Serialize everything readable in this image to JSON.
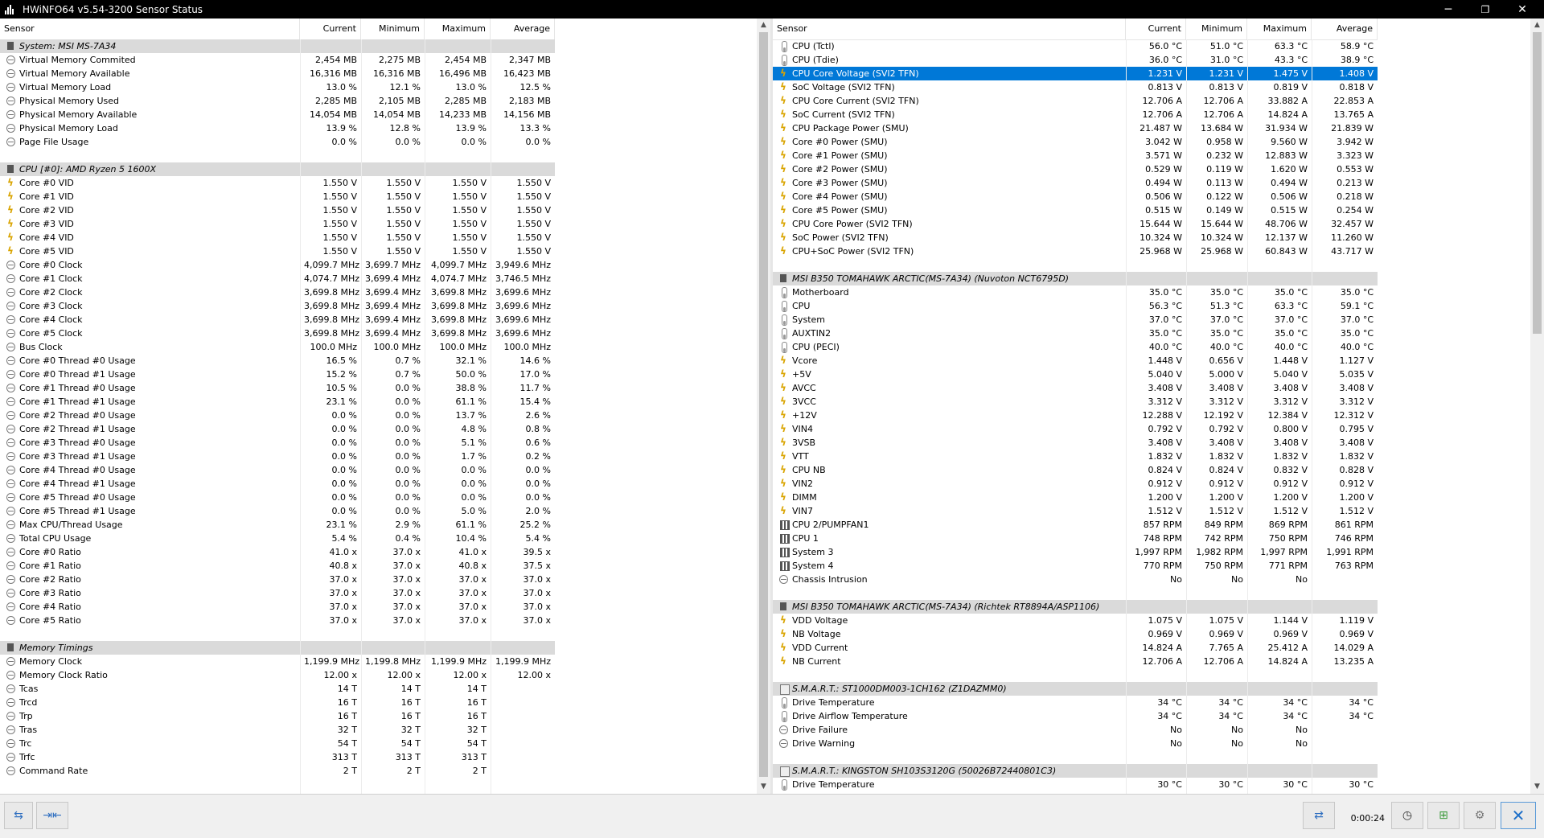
{
  "window": {
    "title": "HWiNFO64 v5.54-3200 Sensor Status",
    "minimize_glyph": "─",
    "maximize_glyph": "❐",
    "close_glyph": "✕"
  },
  "columns": [
    "Sensor",
    "Current",
    "Minimum",
    "Maximum",
    "Average"
  ],
  "left_rows": [
    {
      "t": "group",
      "icon": "chip",
      "name": "System: MSI MS-7A34"
    },
    {
      "icon": "clock",
      "name": "Virtual Memory Commited",
      "v": [
        "2,454 MB",
        "2,275 MB",
        "2,454 MB",
        "2,347 MB"
      ]
    },
    {
      "icon": "clock",
      "name": "Virtual Memory Available",
      "v": [
        "16,316 MB",
        "16,316 MB",
        "16,496 MB",
        "16,423 MB"
      ]
    },
    {
      "icon": "clock",
      "name": "Virtual Memory Load",
      "v": [
        "13.0 %",
        "12.1 %",
        "13.0 %",
        "12.5 %"
      ]
    },
    {
      "icon": "clock",
      "name": "Physical Memory Used",
      "v": [
        "2,285 MB",
        "2,105 MB",
        "2,285 MB",
        "2,183 MB"
      ]
    },
    {
      "icon": "clock",
      "name": "Physical Memory Available",
      "v": [
        "14,054 MB",
        "14,054 MB",
        "14,233 MB",
        "14,156 MB"
      ]
    },
    {
      "icon": "clock",
      "name": "Physical Memory Load",
      "v": [
        "13.9 %",
        "12.8 %",
        "13.9 %",
        "13.3 %"
      ]
    },
    {
      "icon": "clock",
      "name": "Page File Usage",
      "v": [
        "0.0 %",
        "0.0 %",
        "0.0 %",
        "0.0 %"
      ]
    },
    {
      "t": "spacer"
    },
    {
      "t": "group",
      "icon": "chip",
      "name": "CPU [#0]: AMD Ryzen 5 1600X"
    },
    {
      "icon": "volt",
      "name": "Core #0 VID",
      "v": [
        "1.550 V",
        "1.550 V",
        "1.550 V",
        "1.550 V"
      ]
    },
    {
      "icon": "volt",
      "name": "Core #1 VID",
      "v": [
        "1.550 V",
        "1.550 V",
        "1.550 V",
        "1.550 V"
      ]
    },
    {
      "icon": "volt",
      "name": "Core #2 VID",
      "v": [
        "1.550 V",
        "1.550 V",
        "1.550 V",
        "1.550 V"
      ]
    },
    {
      "icon": "volt",
      "name": "Core #3 VID",
      "v": [
        "1.550 V",
        "1.550 V",
        "1.550 V",
        "1.550 V"
      ]
    },
    {
      "icon": "volt",
      "name": "Core #4 VID",
      "v": [
        "1.550 V",
        "1.550 V",
        "1.550 V",
        "1.550 V"
      ]
    },
    {
      "icon": "volt",
      "name": "Core #5 VID",
      "v": [
        "1.550 V",
        "1.550 V",
        "1.550 V",
        "1.550 V"
      ]
    },
    {
      "icon": "clock",
      "name": "Core #0 Clock",
      "v": [
        "4,099.7 MHz",
        "3,699.7 MHz",
        "4,099.7 MHz",
        "3,949.6 MHz"
      ]
    },
    {
      "icon": "clock",
      "name": "Core #1 Clock",
      "v": [
        "4,074.7 MHz",
        "3,699.4 MHz",
        "4,074.7 MHz",
        "3,746.5 MHz"
      ]
    },
    {
      "icon": "clock",
      "name": "Core #2 Clock",
      "v": [
        "3,699.8 MHz",
        "3,699.4 MHz",
        "3,699.8 MHz",
        "3,699.6 MHz"
      ]
    },
    {
      "icon": "clock",
      "name": "Core #3 Clock",
      "v": [
        "3,699.8 MHz",
        "3,699.4 MHz",
        "3,699.8 MHz",
        "3,699.6 MHz"
      ]
    },
    {
      "icon": "clock",
      "name": "Core #4 Clock",
      "v": [
        "3,699.8 MHz",
        "3,699.4 MHz",
        "3,699.8 MHz",
        "3,699.6 MHz"
      ]
    },
    {
      "icon": "clock",
      "name": "Core #5 Clock",
      "v": [
        "3,699.8 MHz",
        "3,699.4 MHz",
        "3,699.8 MHz",
        "3,699.6 MHz"
      ]
    },
    {
      "icon": "clock",
      "name": "Bus Clock",
      "v": [
        "100.0 MHz",
        "100.0 MHz",
        "100.0 MHz",
        "100.0 MHz"
      ]
    },
    {
      "icon": "clock",
      "name": "Core #0 Thread #0 Usage",
      "v": [
        "16.5 %",
        "0.7 %",
        "32.1 %",
        "14.6 %"
      ]
    },
    {
      "icon": "clock",
      "name": "Core #0 Thread #1 Usage",
      "v": [
        "15.2 %",
        "0.7 %",
        "50.0 %",
        "17.0 %"
      ]
    },
    {
      "icon": "clock",
      "name": "Core #1 Thread #0 Usage",
      "v": [
        "10.5 %",
        "0.0 %",
        "38.8 %",
        "11.7 %"
      ]
    },
    {
      "icon": "clock",
      "name": "Core #1 Thread #1 Usage",
      "v": [
        "23.1 %",
        "0.0 %",
        "61.1 %",
        "15.4 %"
      ]
    },
    {
      "icon": "clock",
      "name": "Core #2 Thread #0 Usage",
      "v": [
        "0.0 %",
        "0.0 %",
        "13.7 %",
        "2.6 %"
      ]
    },
    {
      "icon": "clock",
      "name": "Core #2 Thread #1 Usage",
      "v": [
        "0.0 %",
        "0.0 %",
        "4.8 %",
        "0.8 %"
      ]
    },
    {
      "icon": "clock",
      "name": "Core #3 Thread #0 Usage",
      "v": [
        "0.0 %",
        "0.0 %",
        "5.1 %",
        "0.6 %"
      ]
    },
    {
      "icon": "clock",
      "name": "Core #3 Thread #1 Usage",
      "v": [
        "0.0 %",
        "0.0 %",
        "1.7 %",
        "0.2 %"
      ]
    },
    {
      "icon": "clock",
      "name": "Core #4 Thread #0 Usage",
      "v": [
        "0.0 %",
        "0.0 %",
        "0.0 %",
        "0.0 %"
      ]
    },
    {
      "icon": "clock",
      "name": "Core #4 Thread #1 Usage",
      "v": [
        "0.0 %",
        "0.0 %",
        "0.0 %",
        "0.0 %"
      ]
    },
    {
      "icon": "clock",
      "name": "Core #5 Thread #0 Usage",
      "v": [
        "0.0 %",
        "0.0 %",
        "0.0 %",
        "0.0 %"
      ]
    },
    {
      "icon": "clock",
      "name": "Core #5 Thread #1 Usage",
      "v": [
        "0.0 %",
        "0.0 %",
        "5.0 %",
        "2.0 %"
      ]
    },
    {
      "icon": "clock",
      "name": "Max CPU/Thread Usage",
      "v": [
        "23.1 %",
        "2.9 %",
        "61.1 %",
        "25.2 %"
      ]
    },
    {
      "icon": "clock",
      "name": "Total CPU Usage",
      "v": [
        "5.4 %",
        "0.4 %",
        "10.4 %",
        "5.4 %"
      ]
    },
    {
      "icon": "clock",
      "name": "Core #0 Ratio",
      "v": [
        "41.0 x",
        "37.0 x",
        "41.0 x",
        "39.5 x"
      ]
    },
    {
      "icon": "clock",
      "name": "Core #1 Ratio",
      "v": [
        "40.8 x",
        "37.0 x",
        "40.8 x",
        "37.5 x"
      ]
    },
    {
      "icon": "clock",
      "name": "Core #2 Ratio",
      "v": [
        "37.0 x",
        "37.0 x",
        "37.0 x",
        "37.0 x"
      ]
    },
    {
      "icon": "clock",
      "name": "Core #3 Ratio",
      "v": [
        "37.0 x",
        "37.0 x",
        "37.0 x",
        "37.0 x"
      ]
    },
    {
      "icon": "clock",
      "name": "Core #4 Ratio",
      "v": [
        "37.0 x",
        "37.0 x",
        "37.0 x",
        "37.0 x"
      ]
    },
    {
      "icon": "clock",
      "name": "Core #5 Ratio",
      "v": [
        "37.0 x",
        "37.0 x",
        "37.0 x",
        "37.0 x"
      ]
    },
    {
      "t": "spacer"
    },
    {
      "t": "group",
      "icon": "chip",
      "name": "Memory Timings"
    },
    {
      "icon": "clock",
      "name": "Memory Clock",
      "v": [
        "1,199.9 MHz",
        "1,199.8 MHz",
        "1,199.9 MHz",
        "1,199.9 MHz"
      ]
    },
    {
      "icon": "clock",
      "name": "Memory Clock Ratio",
      "v": [
        "12.00 x",
        "12.00 x",
        "12.00 x",
        "12.00 x"
      ]
    },
    {
      "icon": "clock",
      "name": "Tcas",
      "v": [
        "14 T",
        "14 T",
        "14 T",
        ""
      ]
    },
    {
      "icon": "clock",
      "name": "Trcd",
      "v": [
        "16 T",
        "16 T",
        "16 T",
        ""
      ]
    },
    {
      "icon": "clock",
      "name": "Trp",
      "v": [
        "16 T",
        "16 T",
        "16 T",
        ""
      ]
    },
    {
      "icon": "clock",
      "name": "Tras",
      "v": [
        "32 T",
        "32 T",
        "32 T",
        ""
      ]
    },
    {
      "icon": "clock",
      "name": "Trc",
      "v": [
        "54 T",
        "54 T",
        "54 T",
        ""
      ]
    },
    {
      "icon": "clock",
      "name": "Trfc",
      "v": [
        "313 T",
        "313 T",
        "313 T",
        ""
      ]
    },
    {
      "icon": "clock",
      "name": "Command Rate",
      "v": [
        "2 T",
        "2 T",
        "2 T",
        ""
      ]
    }
  ],
  "right_rows": [
    {
      "icon": "temp",
      "name": "CPU (Tctl)",
      "v": [
        "56.0 °C",
        "51.0 °C",
        "63.3 °C",
        "58.9 °C"
      ]
    },
    {
      "icon": "temp",
      "name": "CPU (Tdie)",
      "v": [
        "36.0 °C",
        "31.0 °C",
        "43.3 °C",
        "38.9 °C"
      ]
    },
    {
      "icon": "volt",
      "name": "CPU Core Voltage (SVI2 TFN)",
      "v": [
        "1.231 V",
        "1.231 V",
        "1.475 V",
        "1.408 V"
      ],
      "selected": true
    },
    {
      "icon": "volt",
      "name": "SoC Voltage (SVI2 TFN)",
      "v": [
        "0.813 V",
        "0.813 V",
        "0.819 V",
        "0.818 V"
      ]
    },
    {
      "icon": "volt",
      "name": "CPU Core Current (SVI2 TFN)",
      "v": [
        "12.706 A",
        "12.706 A",
        "33.882 A",
        "22.853 A"
      ]
    },
    {
      "icon": "volt",
      "name": "SoC Current (SVI2 TFN)",
      "v": [
        "12.706 A",
        "12.706 A",
        "14.824 A",
        "13.765 A"
      ]
    },
    {
      "icon": "volt",
      "name": "CPU Package Power (SMU)",
      "v": [
        "21.487 W",
        "13.684 W",
        "31.934 W",
        "21.839 W"
      ]
    },
    {
      "icon": "volt",
      "name": "Core #0 Power (SMU)",
      "v": [
        "3.042 W",
        "0.958 W",
        "9.560 W",
        "3.942 W"
      ]
    },
    {
      "icon": "volt",
      "name": "Core #1 Power (SMU)",
      "v": [
        "3.571 W",
        "0.232 W",
        "12.883 W",
        "3.323 W"
      ]
    },
    {
      "icon": "volt",
      "name": "Core #2 Power (SMU)",
      "v": [
        "0.529 W",
        "0.119 W",
        "1.620 W",
        "0.553 W"
      ]
    },
    {
      "icon": "volt",
      "name": "Core #3 Power (SMU)",
      "v": [
        "0.494 W",
        "0.113 W",
        "0.494 W",
        "0.213 W"
      ]
    },
    {
      "icon": "volt",
      "name": "Core #4 Power (SMU)",
      "v": [
        "0.506 W",
        "0.122 W",
        "0.506 W",
        "0.218 W"
      ]
    },
    {
      "icon": "volt",
      "name": "Core #5 Power (SMU)",
      "v": [
        "0.515 W",
        "0.149 W",
        "0.515 W",
        "0.254 W"
      ]
    },
    {
      "icon": "volt",
      "name": "CPU Core Power (SVI2 TFN)",
      "v": [
        "15.644 W",
        "15.644 W",
        "48.706 W",
        "32.457 W"
      ]
    },
    {
      "icon": "volt",
      "name": "SoC Power (SVI2 TFN)",
      "v": [
        "10.324 W",
        "10.324 W",
        "12.137 W",
        "11.260 W"
      ]
    },
    {
      "icon": "volt",
      "name": "CPU+SoC Power (SVI2 TFN)",
      "v": [
        "25.968 W",
        "25.968 W",
        "60.843 W",
        "43.717 W"
      ]
    },
    {
      "t": "spacer"
    },
    {
      "t": "group",
      "icon": "chip",
      "name": "MSI B350 TOMAHAWK ARCTIC(MS-7A34) (Nuvoton NCT6795D)"
    },
    {
      "icon": "temp",
      "name": "Motherboard",
      "v": [
        "35.0 °C",
        "35.0 °C",
        "35.0 °C",
        "35.0 °C"
      ]
    },
    {
      "icon": "temp",
      "name": "CPU",
      "v": [
        "56.3 °C",
        "51.3 °C",
        "63.3 °C",
        "59.1 °C"
      ]
    },
    {
      "icon": "temp",
      "name": "System",
      "v": [
        "37.0 °C",
        "37.0 °C",
        "37.0 °C",
        "37.0 °C"
      ]
    },
    {
      "icon": "temp",
      "name": "AUXTIN2",
      "v": [
        "35.0 °C",
        "35.0 °C",
        "35.0 °C",
        "35.0 °C"
      ]
    },
    {
      "icon": "temp",
      "name": "CPU (PECI)",
      "v": [
        "40.0 °C",
        "40.0 °C",
        "40.0 °C",
        "40.0 °C"
      ]
    },
    {
      "icon": "volt",
      "name": "Vcore",
      "v": [
        "1.448 V",
        "0.656 V",
        "1.448 V",
        "1.127 V"
      ]
    },
    {
      "icon": "volt",
      "name": "+5V",
      "v": [
        "5.040 V",
        "5.000 V",
        "5.040 V",
        "5.035 V"
      ]
    },
    {
      "icon": "volt",
      "name": "AVCC",
      "v": [
        "3.408 V",
        "3.408 V",
        "3.408 V",
        "3.408 V"
      ]
    },
    {
      "icon": "volt",
      "name": "3VCC",
      "v": [
        "3.312 V",
        "3.312 V",
        "3.312 V",
        "3.312 V"
      ]
    },
    {
      "icon": "volt",
      "name": "+12V",
      "v": [
        "12.288 V",
        "12.192 V",
        "12.384 V",
        "12.312 V"
      ]
    },
    {
      "icon": "volt",
      "name": "VIN4",
      "v": [
        "0.792 V",
        "0.792 V",
        "0.800 V",
        "0.795 V"
      ]
    },
    {
      "icon": "volt",
      "name": "3VSB",
      "v": [
        "3.408 V",
        "3.408 V",
        "3.408 V",
        "3.408 V"
      ]
    },
    {
      "icon": "volt",
      "name": "VTT",
      "v": [
        "1.832 V",
        "1.832 V",
        "1.832 V",
        "1.832 V"
      ]
    },
    {
      "icon": "volt",
      "name": "CPU NB",
      "v": [
        "0.824 V",
        "0.824 V",
        "0.832 V",
        "0.828 V"
      ]
    },
    {
      "icon": "volt",
      "name": "VIN2",
      "v": [
        "0.912 V",
        "0.912 V",
        "0.912 V",
        "0.912 V"
      ]
    },
    {
      "icon": "volt",
      "name": "DIMM",
      "v": [
        "1.200 V",
        "1.200 V",
        "1.200 V",
        "1.200 V"
      ]
    },
    {
      "icon": "volt",
      "name": "VIN7",
      "v": [
        "1.512 V",
        "1.512 V",
        "1.512 V",
        "1.512 V"
      ]
    },
    {
      "icon": "fan",
      "name": "CPU 2/PUMPFAN1",
      "v": [
        "857 RPM",
        "849 RPM",
        "869 RPM",
        "861 RPM"
      ]
    },
    {
      "icon": "fan",
      "name": "CPU 1",
      "v": [
        "748 RPM",
        "742 RPM",
        "750 RPM",
        "746 RPM"
      ]
    },
    {
      "icon": "fan",
      "name": "System 3",
      "v": [
        "1,997 RPM",
        "1,982 RPM",
        "1,997 RPM",
        "1,991 RPM"
      ]
    },
    {
      "icon": "fan",
      "name": "System 4",
      "v": [
        "770 RPM",
        "750 RPM",
        "771 RPM",
        "763 RPM"
      ]
    },
    {
      "icon": "clock",
      "name": "Chassis Intrusion",
      "v": [
        "No",
        "No",
        "No",
        ""
      ]
    },
    {
      "t": "spacer"
    },
    {
      "t": "group",
      "icon": "chip",
      "name": "MSI B350 TOMAHAWK ARCTIC(MS-7A34) (Richtek RT8894A/ASP1106)"
    },
    {
      "icon": "volt",
      "name": "VDD Voltage",
      "v": [
        "1.075 V",
        "1.075 V",
        "1.144 V",
        "1.119 V"
      ]
    },
    {
      "icon": "volt",
      "name": "NB Voltage",
      "v": [
        "0.969 V",
        "0.969 V",
        "0.969 V",
        "0.969 V"
      ]
    },
    {
      "icon": "volt",
      "name": "VDD Current",
      "v": [
        "14.824 A",
        "7.765 A",
        "25.412 A",
        "14.029 A"
      ]
    },
    {
      "icon": "volt",
      "name": "NB Current",
      "v": [
        "12.706 A",
        "12.706 A",
        "14.824 A",
        "13.235 A"
      ]
    },
    {
      "t": "spacer"
    },
    {
      "t": "group",
      "icon": "drive",
      "name": "S.M.A.R.T.: ST1000DM003-1CH162 (Z1DAZMM0)"
    },
    {
      "icon": "temp",
      "name": "Drive Temperature",
      "v": [
        "34 °C",
        "34 °C",
        "34 °C",
        "34 °C"
      ]
    },
    {
      "icon": "temp",
      "name": "Drive Airflow Temperature",
      "v": [
        "34 °C",
        "34 °C",
        "34 °C",
        "34 °C"
      ]
    },
    {
      "icon": "clock",
      "name": "Drive Failure",
      "v": [
        "No",
        "No",
        "No",
        ""
      ]
    },
    {
      "icon": "clock",
      "name": "Drive Warning",
      "v": [
        "No",
        "No",
        "No",
        ""
      ]
    },
    {
      "t": "spacer"
    },
    {
      "t": "group",
      "icon": "drive",
      "name": "S.M.A.R.T.: KINGSTON SH103S3120G (50026B72440801C3)"
    },
    {
      "icon": "temp",
      "name": "Drive Temperature",
      "v": [
        "30 °C",
        "30 °C",
        "30 °C",
        "30 °C"
      ]
    }
  ],
  "toolbar": {
    "timer": "0:00:24",
    "nav_left_icon": "double-arrow-icon",
    "nav_right_icon": "collapse-arrows-icon"
  },
  "colors": {
    "selection": "#0078d7",
    "group_row": "#dadada",
    "titlebar": "#000000"
  }
}
